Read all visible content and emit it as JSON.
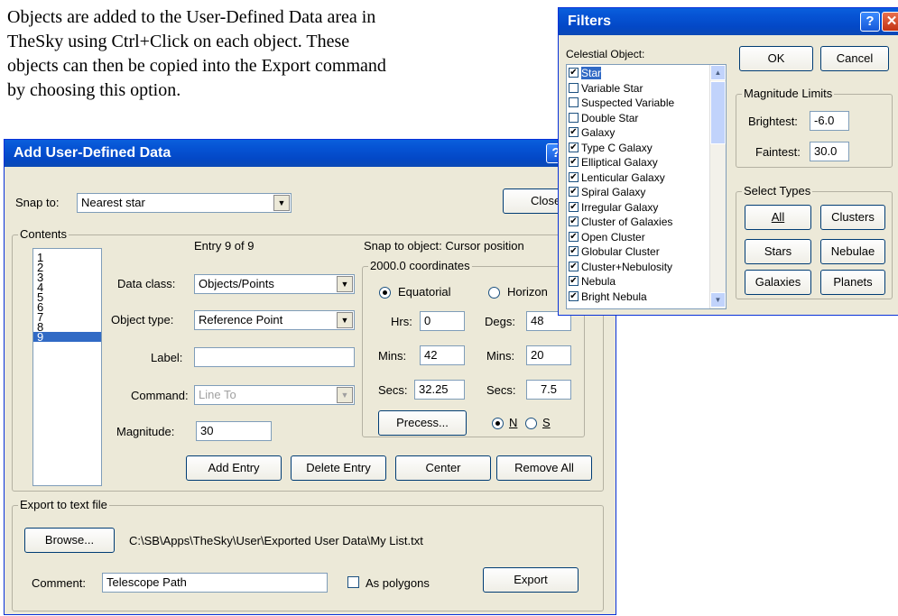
{
  "doc": {
    "lines": [
      "Objects are added to the User-Defined Data area in",
      "TheSky using Ctrl+Click on each object. These",
      "objects can then be copied into the Export command",
      "by choosing this option."
    ]
  },
  "add_dialog": {
    "title": "Add User-Defined Data",
    "snap_label": "Snap to:",
    "snap_value": "Nearest star",
    "close_label": "Close",
    "contents_label": "Contents",
    "entries": [
      "1",
      "2",
      "3",
      "4",
      "5",
      "6",
      "7",
      "8",
      "9"
    ],
    "selected_entry": "9",
    "entry_text": "Entry 9 of 9",
    "snap_object_text": "Snap to object:  Cursor position",
    "data_class_label": "Data class:",
    "data_class_value": "Objects/Points",
    "object_type_label": "Object type:",
    "object_type_value": "Reference Point",
    "label_label": "Label:",
    "label_value": "",
    "command_label": "Command:",
    "command_value": "Line To",
    "magnitude_label": "Magnitude:",
    "magnitude_value": "30",
    "coords_group": "2000.0 coordinates",
    "equatorial_label": "Equatorial",
    "horizon_label": "Horizon",
    "hrs_label": "Hrs:",
    "hrs_value": "0",
    "mins_label": "Mins:",
    "mins_value": "42",
    "secs_label": "Secs:",
    "secs_value": "32.25",
    "degs_label": "Degs:",
    "degs_value": "48",
    "dmins_label": "Mins:",
    "dmins_value": "20",
    "dsecs_label": "Secs:",
    "dsecs_value": "7.5",
    "precess_label": "Precess...",
    "n_label": "N",
    "s_label": "S",
    "add_entry_label": "Add Entry",
    "delete_entry_label": "Delete Entry",
    "center_label": "Center",
    "remove_all_label": "Remove All",
    "export_group": "Export to text file",
    "browse_label": "Browse...",
    "export_path": "C:\\SB\\Apps\\TheSky\\User\\Exported User Data\\My List.txt",
    "comment_label": "Comment:",
    "comment_value": "Telescope Path",
    "polygons_label": "As polygons",
    "export_label": "Export"
  },
  "filters": {
    "title": "Filters",
    "celestial_label": "Celestial Object:",
    "items": [
      {
        "label": "Star",
        "checked": true
      },
      {
        "label": "Variable Star",
        "checked": false
      },
      {
        "label": "Suspected Variable",
        "checked": false
      },
      {
        "label": "Double Star",
        "checked": false
      },
      {
        "label": "Galaxy",
        "checked": true
      },
      {
        "label": "Type C Galaxy",
        "checked": true
      },
      {
        "label": "Elliptical Galaxy",
        "checked": true
      },
      {
        "label": "Lenticular Galaxy",
        "checked": true
      },
      {
        "label": "Spiral Galaxy",
        "checked": true
      },
      {
        "label": "Irregular Galaxy",
        "checked": true
      },
      {
        "label": "Cluster of Galaxies",
        "checked": true
      },
      {
        "label": "Open Cluster",
        "checked": true
      },
      {
        "label": "Globular Cluster",
        "checked": true
      },
      {
        "label": "Cluster+Nebulosity",
        "checked": true
      },
      {
        "label": "Nebula",
        "checked": true
      },
      {
        "label": "Bright Nebula",
        "checked": true
      }
    ],
    "ok_label": "OK",
    "cancel_label": "Cancel",
    "magnitude_group": "Magnitude Limits",
    "brightest_label": "Brightest:",
    "brightest_value": "-6.0",
    "faintest_label": "Faintest:",
    "faintest_value": "30.0",
    "select_group": "Select Types",
    "all_label": "All",
    "clusters_label": "Clusters",
    "stars_label": "Stars",
    "nebulae_label": "Nebulae",
    "galaxies_label": "Galaxies",
    "planets_label": "Planets"
  }
}
